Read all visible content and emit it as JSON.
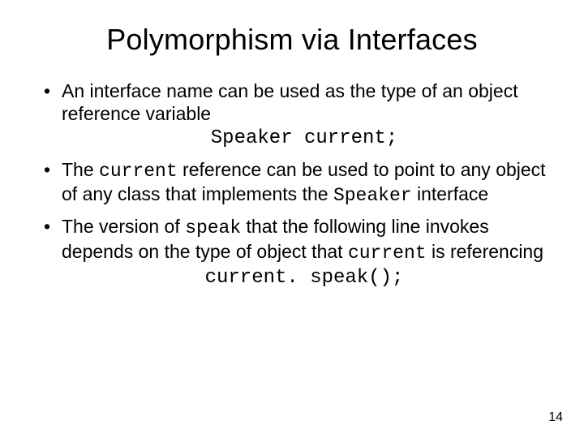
{
  "title": "Polymorphism via Interfaces",
  "bullets": {
    "b1": {
      "text": "An interface name can be used as the type of an object reference variable",
      "code": "Speaker current;"
    },
    "b2": {
      "pre": "The ",
      "code1": "current",
      "mid": " reference can be used to point to any object of any class that implements the ",
      "code2": "Speaker",
      "post": " interface"
    },
    "b3": {
      "pre": "The version of ",
      "code1": "speak",
      "mid": " that the following line invokes depends on the type of object that ",
      "code2": "current",
      "post": " is referencing",
      "codeline": "current. speak();"
    }
  },
  "page_number": "14"
}
